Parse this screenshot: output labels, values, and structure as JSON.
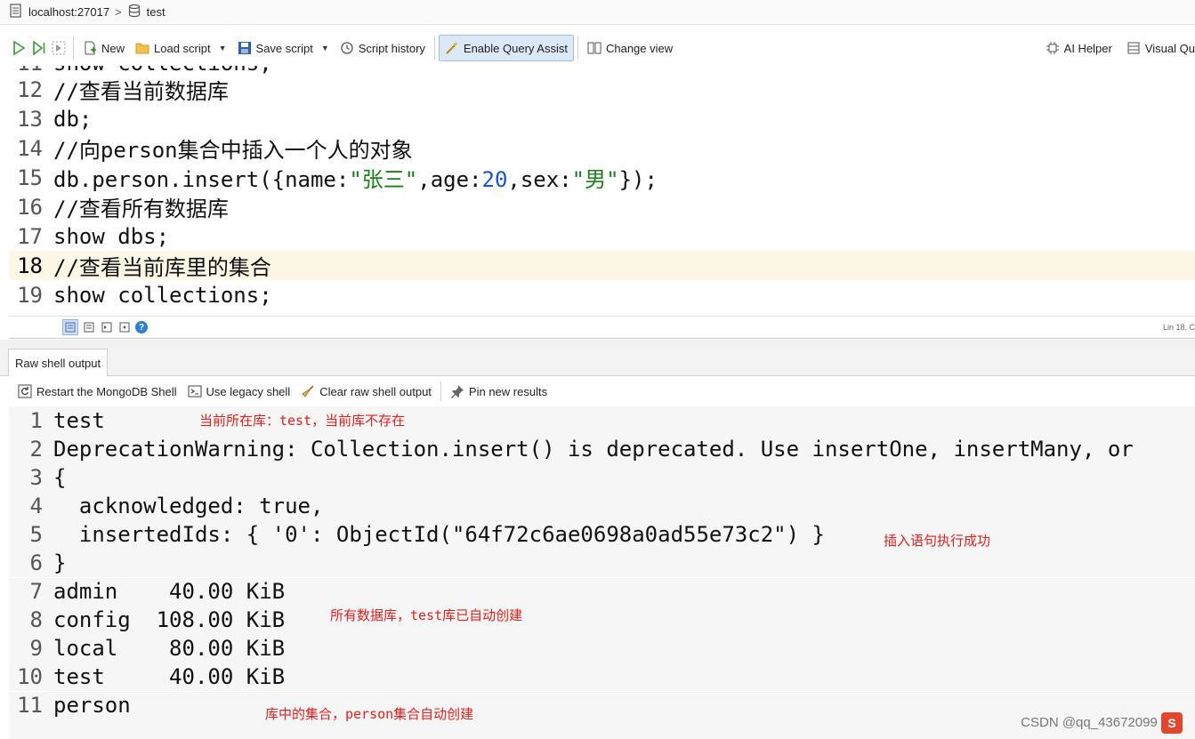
{
  "breadcrumb": {
    "host": "localhost:27017",
    "separator": ">",
    "database": "test"
  },
  "toolbar": {
    "new_label": "New",
    "load_label": "Load script",
    "save_label": "Save script",
    "history_label": "Script history",
    "assist_label": "Enable Query Assist",
    "change_view_label": "Change view",
    "ai_label": "AI Helper",
    "visual_label": "Visual Qu"
  },
  "editor": {
    "partial_top": "show collections;",
    "line_numbers": [
      "12",
      "13",
      "14",
      "15",
      "16",
      "17",
      "18",
      "19"
    ],
    "lines": {
      "l12": "//查看当前数据库",
      "l13": "db;",
      "l14": "//向person集合中插入一个人的对象",
      "l15_a": "db.person.insert({name:",
      "l15_b": "\"张三\"",
      "l15_c": ",age:",
      "l15_d": "20",
      "l15_e": ",sex:",
      "l15_f": "\"男\"",
      "l15_g": "});",
      "l16": "//查看所有数据库",
      "l17": "show dbs;",
      "l18": "//查看当前库里的集合",
      "l19": "show collections;"
    },
    "current_line": 18,
    "status": "Lin 18, C"
  },
  "output_tab": {
    "label": "Raw shell output"
  },
  "output_toolbar": {
    "restart_label": "Restart the MongoDB Shell",
    "legacy_label": "Use legacy shell",
    "clear_label": "Clear raw shell output",
    "pin_label": "Pin new results"
  },
  "output": {
    "line_numbers": [
      "1",
      "2",
      "3",
      "4",
      "5",
      "6",
      "7",
      "8",
      "9",
      "10",
      "11"
    ],
    "lines": {
      "o1": "test",
      "o2": "DeprecationWarning: Collection.insert() is deprecated. Use insertOne, insertMany, or",
      "o3": "{",
      "o4": "  acknowledged: true,",
      "o5": "  insertedIds: { '0': ObjectId(\"64f72c6ae0698a0ad55e73c2\") }",
      "o6": "}",
      "o7": "admin    40.00 KiB",
      "o8": "config  108.00 KiB",
      "o9": "local    80.00 KiB",
      "o10": "test     40.00 KiB",
      "o11": "person"
    },
    "notes": {
      "n1": "当前所在库：test，当前库不存在",
      "n2": "插入语句执行成功",
      "n3": "所有数据库，test库已自动创建",
      "n4": "库中的集合，person集合自动创建"
    }
  },
  "watermark": {
    "text": "CSDN @qq_43672099",
    "logo": "S"
  },
  "colors": {
    "comment": "#8a8a8a",
    "string": "#1a7f1a",
    "number": "#1a55c9",
    "note": "#e0201c",
    "current_line": "#fdf8e6"
  }
}
